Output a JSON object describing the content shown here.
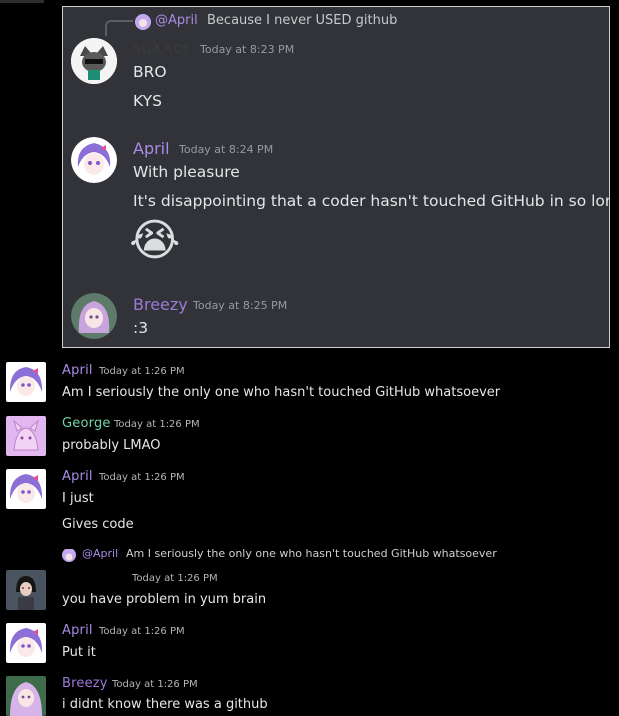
{
  "embed": {
    "reply": {
      "mention": "@April",
      "text": "Because I never USED github"
    },
    "messages": [
      {
        "author": "suXXor",
        "time": "Today at 8:23 PM",
        "lines": [
          "BRO",
          "KYS"
        ],
        "author_color": "#3a3a3a"
      },
      {
        "author": "April",
        "time": "Today at 8:24 PM",
        "lines": [
          "With pleasure",
          "It's disappointing that a coder hasn't touched GitHub in so long"
        ],
        "emoji": "😭",
        "author_color": "#a98be6"
      },
      {
        "author": "Breezy",
        "time": "Today at 8:25 PM",
        "lines": [
          ":3"
        ],
        "author_color": "#9b7ad8"
      }
    ]
  },
  "chat": {
    "m1": {
      "author": "April",
      "time": "Today at 1:26 PM",
      "text": "Am I seriously the only one who hasn't touched GitHub whatsoever"
    },
    "m2": {
      "author": "George",
      "time": "Today at 1:26 PM",
      "text": "probably LMAO"
    },
    "m3": {
      "author": "April",
      "time": "Today at 1:26 PM",
      "line1": "I just",
      "line2": "Gives code"
    },
    "m4": {
      "reply_mention": "@April",
      "reply_text": "Am I seriously the only one who hasn't touched GitHub whatsoever",
      "time": "Today at 1:26 PM",
      "text": "you have problem in yum brain"
    },
    "m5": {
      "author": "April",
      "time": "Today at 1:26 PM",
      "text": "Put it"
    },
    "m6": {
      "author": "Breezy",
      "time": "Today at 1:26 PM",
      "text": "i didnt know there was a github"
    }
  },
  "colors": {
    "april": "#a98be6",
    "george": "#6fd3a8",
    "breezy": "#9b7ad8",
    "background": "#000000",
    "embed_bg": "#313338"
  }
}
